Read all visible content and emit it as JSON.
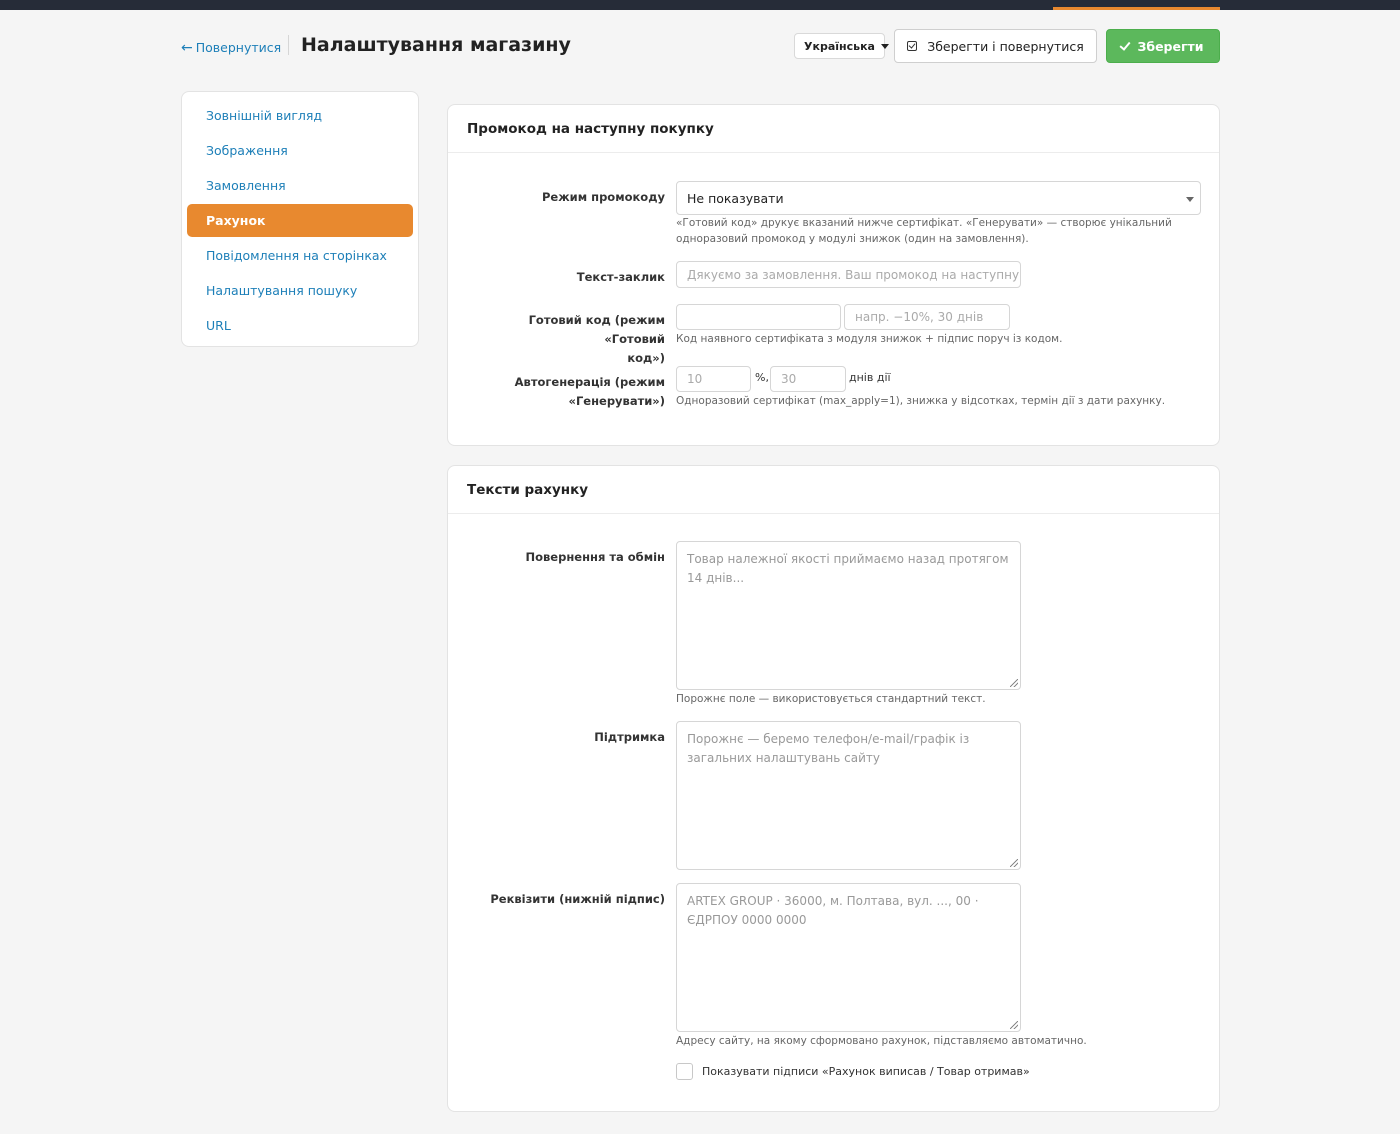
{
  "header": {
    "back_label": "Повернутися",
    "title": "Налаштування магазину",
    "language": "Українська",
    "save_return_label": "Зберегти і повернутися",
    "save_label": "Зберегти"
  },
  "sidebar": {
    "items": [
      {
        "label": "Зовнішній вигляд",
        "active": false
      },
      {
        "label": "Зображення",
        "active": false
      },
      {
        "label": "Замовлення",
        "active": false
      },
      {
        "label": "Рахунок",
        "active": true
      },
      {
        "label": "Повідомлення на сторінках",
        "active": false
      },
      {
        "label": "Налаштування пошуку",
        "active": false
      },
      {
        "label": "URL",
        "active": false
      }
    ]
  },
  "promo_panel": {
    "title": "Промокод на наступну покупку",
    "mode_label": "Режим промокоду",
    "mode_value": "Не показувати",
    "mode_help_1": "«Готовий код» друкує вказаний нижче сертифікат. «Генерувати» — створює унікальний",
    "mode_help_2": "одноразовий промокод у модулі знижок (один на замовлення).",
    "text_label": "Текст-заклик",
    "text_placeholder": "Дякуємо за замовлення. Ваш промокод на наступну г",
    "code_label_1": "Готовий код (режим «Готовий",
    "code_label_2": "код»)",
    "code_value": "",
    "code_note_placeholder": "напр. −10%, 30 днів",
    "code_help": "Код наявного сертифіката з модуля знижок + підпис поруч із кодом.",
    "auto_label_1": "Автогенерація (режим",
    "auto_label_2": "«Генерувати»)",
    "auto_percent_placeholder": "10",
    "auto_percent_unit": "%,",
    "auto_days_placeholder": "30",
    "auto_days_unit": "днів дії",
    "auto_help": "Одноразовий сертифікат (max_apply=1), знижка у відсотках, термін дії з дати рахунку."
  },
  "texts_panel": {
    "title": "Тексти рахунку",
    "returns_label": "Повернення та обмін",
    "returns_placeholder": "Товар належної якості приймаємо назад протягом 14 днів...",
    "returns_help": "Порожнє поле — використовується стандартний текст.",
    "support_label": "Підтримка",
    "support_placeholder": "Порожнє — беремо телефон/e-mail/графік із загальних налаштувань сайту",
    "requisites_label": "Реквізити (нижній підпис)",
    "requisites_placeholder": "ARTEX GROUP · 36000, м. Полтава, вул. ..., 00 · ЄДРПОУ 0000 0000",
    "requisites_help": "Адресу сайту, на якому сформовано рахунок, підставляємо автоматично.",
    "signatures_label": "Показувати підписи «Рахунок виписав / Товар отримав»",
    "signatures_checked": false
  }
}
